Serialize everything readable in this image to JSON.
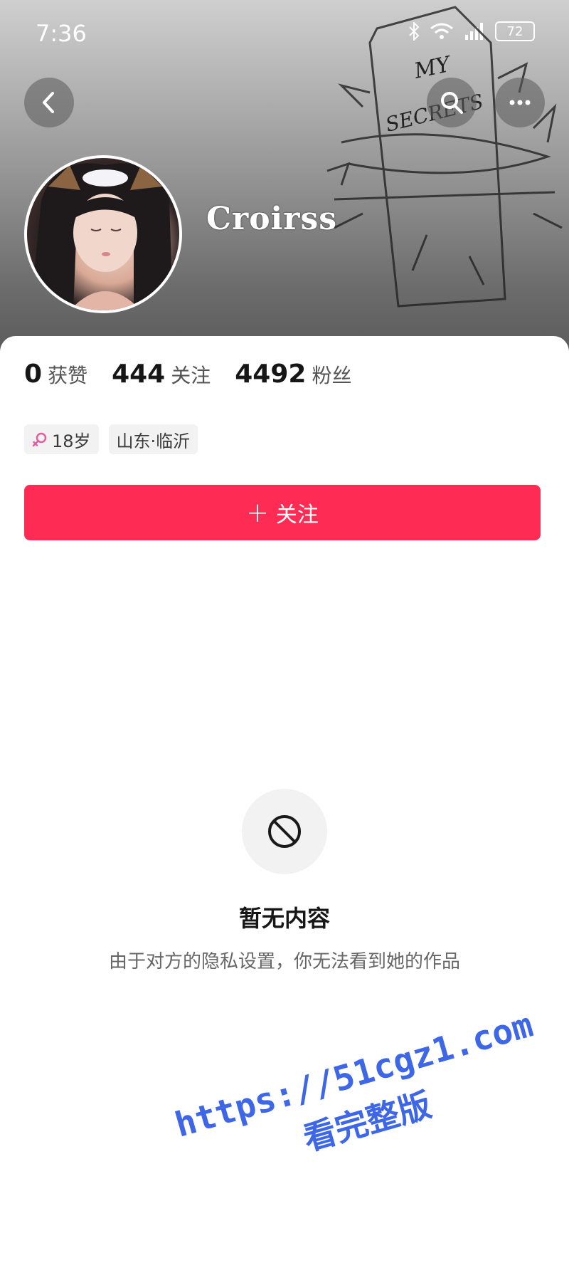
{
  "status_bar": {
    "time": "7:36",
    "battery": "72"
  },
  "header": {
    "username": "Croirss",
    "artwork_text": [
      "MY",
      "SECRETS"
    ]
  },
  "stats": [
    {
      "value": "0",
      "label": "获赞"
    },
    {
      "value": "444",
      "label": "关注"
    },
    {
      "value": "4492",
      "label": "粉丝"
    }
  ],
  "tags": {
    "age": "18岁",
    "location": "山东·临沂"
  },
  "follow_button": {
    "label": "关注"
  },
  "empty_state": {
    "title": "暂无内容",
    "description": "由于对方的隐私设置，你无法看到她的作品"
  },
  "watermark": {
    "url": "https://51cgz1.com",
    "subtitle": "看完整版"
  },
  "colors": {
    "accent": "#fe2c55",
    "watermark": "#3e67e8",
    "female_icon": "#e0609f"
  }
}
